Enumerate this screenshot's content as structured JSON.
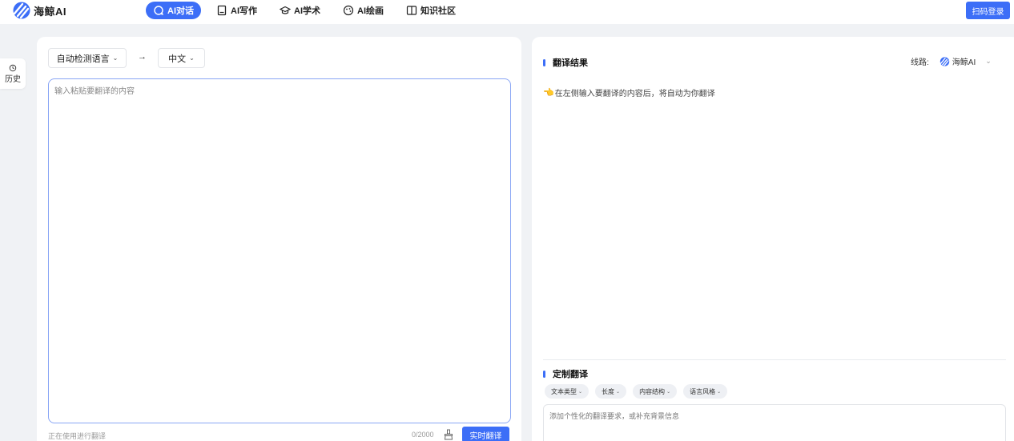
{
  "colors": {
    "accent": "#3c6ef7",
    "page_bg": "#f0f2f5",
    "panel_bg": "#ffffff",
    "input_border": "#8aa6f5"
  },
  "header": {
    "logo_text": "海鲸AI",
    "nav": [
      {
        "label": "AI对话",
        "icon": "chat-icon",
        "active": true
      },
      {
        "label": "AI写作",
        "icon": "notebook-icon",
        "active": false
      },
      {
        "label": "AI学术",
        "icon": "graduation-cap-icon",
        "active": false
      },
      {
        "label": "AI绘画",
        "icon": "palette-icon",
        "active": false
      },
      {
        "label": "知识社区",
        "icon": "book-icon",
        "active": false
      }
    ],
    "login_label": "扫码登录"
  },
  "history": {
    "label": "历史",
    "icon": "history-icon"
  },
  "source": {
    "from_lang": "自动检测语言",
    "to_lang": "中文",
    "swap_icon": "arrow-right-icon",
    "placeholder": "输入粘贴要翻译的内容",
    "status": "正在使用进行翻译",
    "count": "0/2000",
    "clear_icon": "brush-icon",
    "translate_label": "实时翻译"
  },
  "result": {
    "title": "翻译结果",
    "route_label": "线路:",
    "route_value": "海鲸AI",
    "hint": "在左侧输入要翻译的内容后，将自动为你翻译",
    "hint_icon": "pointing-hand-icon"
  },
  "custom": {
    "title": "定制翻译",
    "chips": [
      "文本类型",
      "长度",
      "内容结构",
      "语言风格"
    ],
    "placeholder": "添加个性化的翻译要求，或补充背景信息"
  }
}
